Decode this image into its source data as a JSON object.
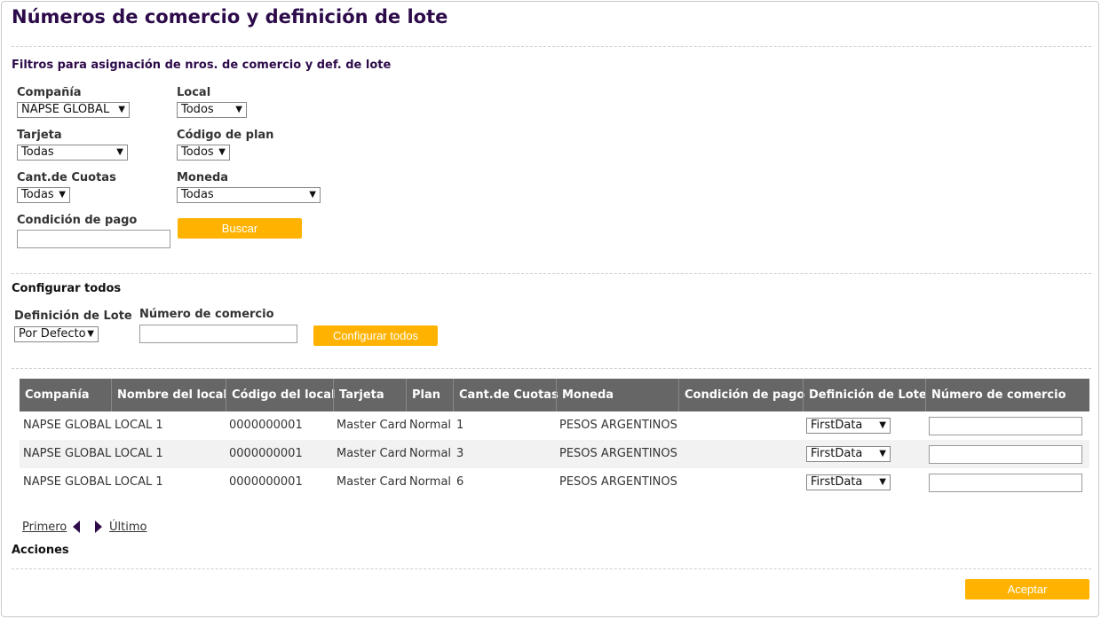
{
  "page": {
    "title": "Números de comercio y definición de lote"
  },
  "filters": {
    "title": "Filtros para asignación de nros. de comercio y def. de lote",
    "compania": {
      "label": "Compañía",
      "value": "NAPSE GLOBAL"
    },
    "local": {
      "label": "Local",
      "value": "Todos"
    },
    "tarjeta": {
      "label": "Tarjeta",
      "value": "Todas"
    },
    "codigo_plan": {
      "label": "Código de plan",
      "value": "Todos"
    },
    "cant_cuotas": {
      "label": "Cant.de Cuotas",
      "value": "Todas"
    },
    "moneda": {
      "label": "Moneda",
      "value": "Todas"
    },
    "condicion_pago": {
      "label": "Condición de pago",
      "value": ""
    },
    "buscar_label": "Buscar"
  },
  "configure_all": {
    "title": "Configurar todos",
    "definicion_lote": {
      "label": "Definición de Lote",
      "value": "Por Defecto"
    },
    "numero_comercio": {
      "label": "Número de comercio",
      "value": ""
    },
    "button_label": "Configurar todos"
  },
  "table": {
    "headers": [
      "Compañía",
      "Nombre del local",
      "Código del local",
      "Tarjeta",
      "Plan",
      "Cant.de Cuotas",
      "Moneda",
      "Condición de pago",
      "Definición de Lote",
      "Número de comercio"
    ],
    "rows": [
      {
        "compania": "NAPSE GLOBAL",
        "local": "LOCAL 1",
        "codigo": "0000000001",
        "tarjeta": "Master Card",
        "plan": "Normal",
        "cuotas": "1",
        "moneda": "PESOS ARGENTINOS",
        "condicion": "",
        "definicion": "FirstData",
        "numero": ""
      },
      {
        "compania": "NAPSE GLOBAL",
        "local": "LOCAL 1",
        "codigo": "0000000001",
        "tarjeta": "Master Card",
        "plan": "Normal",
        "cuotas": "3",
        "moneda": "PESOS ARGENTINOS",
        "condicion": "",
        "definicion": "FirstData",
        "numero": ""
      },
      {
        "compania": "NAPSE GLOBAL",
        "local": "LOCAL 1",
        "codigo": "0000000001",
        "tarjeta": "Master Card",
        "plan": "Normal",
        "cuotas": "6",
        "moneda": "PESOS ARGENTINOS",
        "condicion": "",
        "definicion": "FirstData",
        "numero": ""
      }
    ]
  },
  "pagination": {
    "first": "Primero",
    "last": "Último",
    "prev_icon": "triangle-left-icon",
    "next_icon": "triangle-right-icon"
  },
  "actions": {
    "title": "Acciones",
    "accept_label": "Aceptar"
  },
  "colors": {
    "title": "#2d0b4a",
    "accent": "#ffb300",
    "table_header": "#666666"
  }
}
